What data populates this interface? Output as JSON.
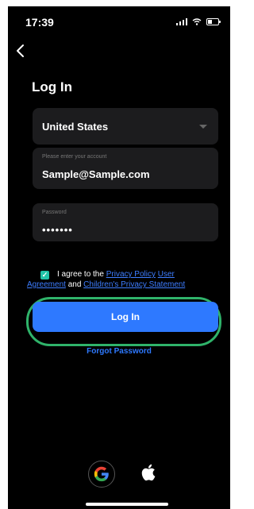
{
  "status_bar": {
    "time": "17:39"
  },
  "header": {
    "title": "Log In"
  },
  "form": {
    "country": "United States",
    "account_placeholder": "Please enter your account",
    "account_value": "Sample@Sample.com",
    "password_placeholder": "Password",
    "password_mask": "•••••••"
  },
  "agreement": {
    "checked": true,
    "prefix": "I agree to the ",
    "privacy_policy": "Privacy Policy",
    "user": "User",
    "agreement_word": "Agreement",
    "and": " and ",
    "childrens": "Children's Privacy Statement"
  },
  "actions": {
    "login_label": "Log In",
    "forgot_label": "Forgot Password"
  },
  "social": {
    "providers": [
      "google-icon",
      "apple-icon"
    ]
  },
  "colors": {
    "background": "#000000",
    "accent": "#2e79ff",
    "check": "#21c3a8",
    "highlight": "#2fb36a",
    "field": "#1c1c1e"
  }
}
